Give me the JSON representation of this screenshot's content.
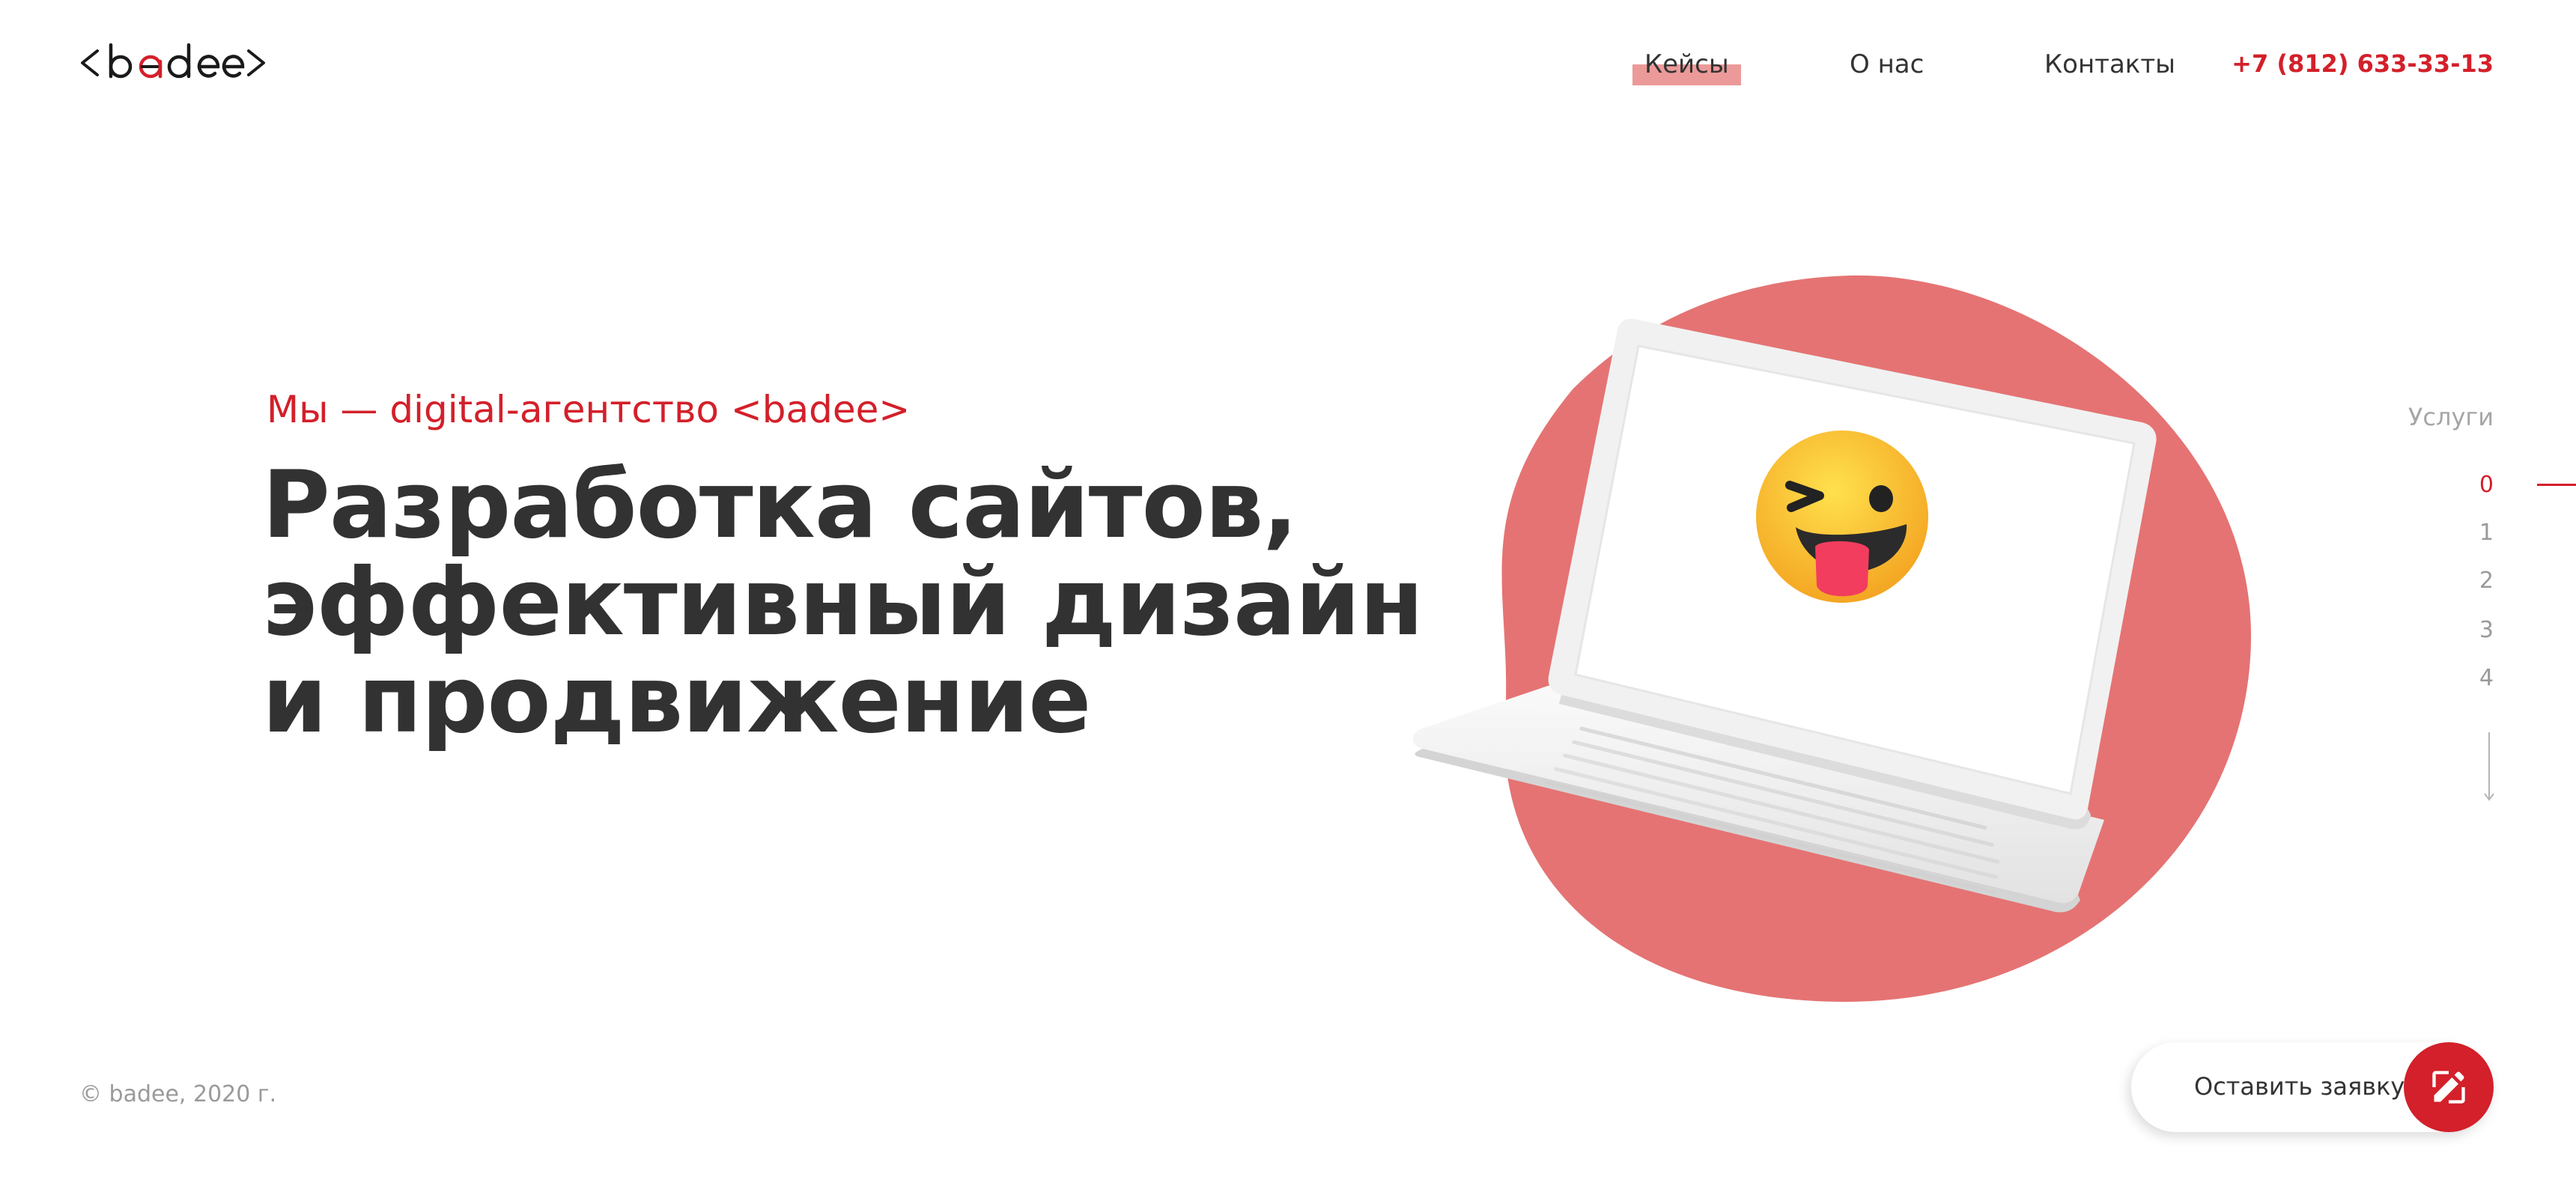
{
  "brand": {
    "logo_text": "<badee>",
    "accent_color": "#d3202a",
    "blob_color": "#e57373"
  },
  "nav": {
    "items": [
      {
        "label": "Кейсы"
      },
      {
        "label": "О нас"
      },
      {
        "label": "Контакты"
      }
    ],
    "phone": "+7 (812) 633-33-13"
  },
  "hero": {
    "eyebrow": "Мы — digital-агентство <badee>",
    "title_lines": [
      "Разработка сайтов,",
      "эффективный дизайн",
      "и продвижение"
    ]
  },
  "illustration": {
    "screen_icon": "winking-tongue-emoji-icon",
    "device_icon": "laptop-icon"
  },
  "section_nav": {
    "title": "Услуги",
    "items": [
      "0",
      "1",
      "2",
      "3",
      "4"
    ],
    "active_index": 0
  },
  "footer": {
    "copyright": "© badee, 2020 г.",
    "cta_label": "Оставить заявку",
    "cta_icon": "edit-icon"
  }
}
